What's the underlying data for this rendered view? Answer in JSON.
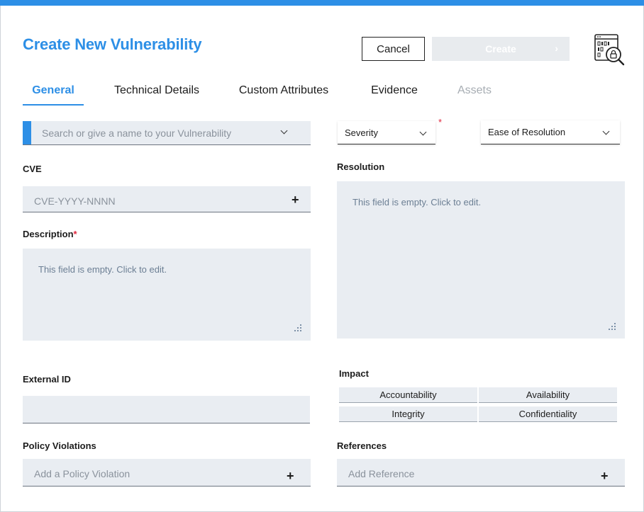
{
  "dialog": {
    "title": "Create New Vulnerability",
    "cancel_label": "Cancel",
    "create_label": "Create",
    "icon": "vulnerability-search-icon",
    "accent_color": "#2d8fe6"
  },
  "tabs": [
    {
      "label": "General",
      "state": "active"
    },
    {
      "label": "Technical Details",
      "state": "normal"
    },
    {
      "label": "Custom Attributes",
      "state": "normal"
    },
    {
      "label": "Evidence",
      "state": "normal"
    },
    {
      "label": "Assets",
      "state": "disabled"
    }
  ],
  "general": {
    "name_search": {
      "placeholder": "Search or give a name to your Vulnerability",
      "value": ""
    },
    "severity": {
      "label": "Severity",
      "required": "*"
    },
    "ease_of_resolution": {
      "label": "Ease of Resolution"
    },
    "cve": {
      "label": "CVE",
      "placeholder": "CVE-YYYY-NNNN"
    },
    "description": {
      "label": "Description",
      "required": "*",
      "empty_text": "This field is empty. Click to edit."
    },
    "resolution": {
      "label": "Resolution",
      "empty_text": "This field is empty. Click to edit."
    },
    "external_id": {
      "label": "External ID",
      "value": ""
    },
    "impact": {
      "label": "Impact",
      "options": [
        "Accountability",
        "Availability",
        "Integrity",
        "Confidentiality"
      ]
    },
    "policy_violations": {
      "label": "Policy Violations",
      "placeholder": "Add a Policy Violation"
    },
    "references": {
      "label": "References",
      "placeholder": "Add Reference"
    }
  }
}
